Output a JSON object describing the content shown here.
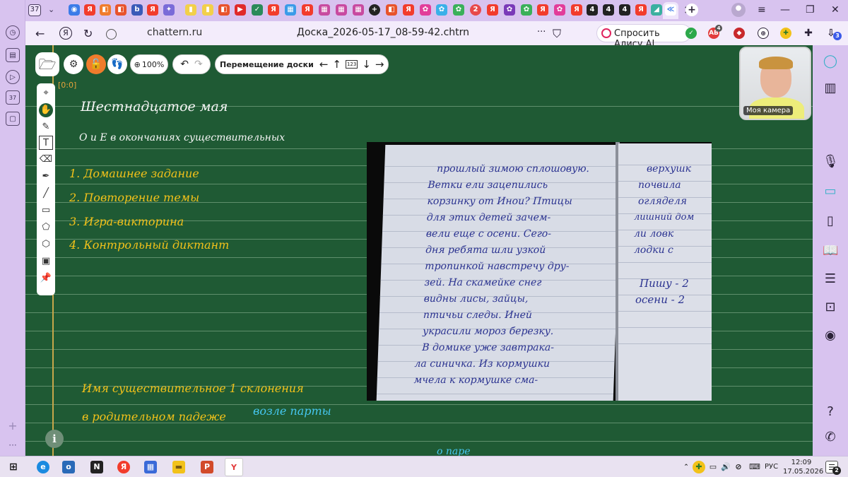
{
  "browser": {
    "tab_count": "37",
    "side_counter": "37",
    "url": "chattern.ru",
    "doc_title": "Доска_2026-05-17_08-59-42.chtrn",
    "alice_button": "Спросить Алису AI",
    "tab_letters": [
      "Я",
      "Я",
      "Я",
      "Я",
      "Я",
      "Я",
      "Я",
      "Я",
      "Я",
      "Я"
    ],
    "tab_numbers": [
      "2",
      "4",
      "4",
      "4"
    ],
    "ext_badge": "4",
    "sidebar_badge": "3"
  },
  "board": {
    "coord_readout": "[0:0]",
    "zoom_label": "100%",
    "move_label": "Перемещение доски",
    "grid_label": "123",
    "date_heading": "Шестнадцатое мая",
    "topic": "О и Е в окончаниях существительных",
    "plan": [
      "1. Домашнее задание",
      "2. Повторение темы",
      "3. Игра-викторина",
      "4. Контрольный диктант"
    ],
    "rule_line1": "Имя существительное 1 склонения",
    "rule_line2": "в родительном падеже",
    "example_cyan": "возле парты",
    "example_cyan_bottom": "о паре"
  },
  "photo": {
    "left_lines": [
      "прошлый зимою сплошовую.",
      "Ветки ели зацепились",
      "корзинку от Инои? Птицы",
      "для этих детей зачем-",
      "вели еще с осени. Сего-",
      "дня ребята шли узкой",
      "тропинкой навстречу дру-",
      "зей. На скамейке снег",
      "видны лисы, зайцы,",
      "птичьи следы. Иней",
      "украсили мороз березку.",
      "В домике уже завтрака-",
      "ла синичка. Из кормушки",
      "мчела к кормушке сма-"
    ],
    "right_lines": [
      "верхушк",
      "почвила",
      "огляделя",
      "лишний дом",
      "ли ловк",
      "лодки с",
      "",
      "Пишу - 2",
      "осени - 2"
    ]
  },
  "camera": {
    "label": "Моя камера"
  },
  "taskbar": {
    "time": "12:09",
    "date": "17.05.2026",
    "lang": "РУС",
    "notif_count": "2"
  }
}
